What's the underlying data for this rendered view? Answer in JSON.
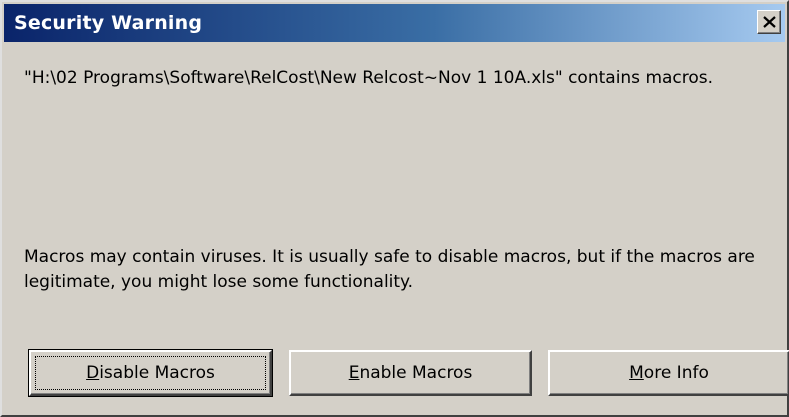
{
  "window": {
    "title": "Security Warning",
    "close_glyph": "×"
  },
  "message": {
    "line1": "\"H:\\02 Programs\\Software\\RelCost\\New Relcost~Nov 1 10A.xls\" contains macros.",
    "line2": "Macros may contain viruses. It is usually safe to disable macros, but if the macros are legitimate, you might lose some functionality."
  },
  "buttons": {
    "disable": {
      "mnemonic": "D",
      "rest": "isable Macros"
    },
    "enable": {
      "mnemonic": "E",
      "rest": "nable Macros"
    },
    "more": {
      "mnemonic": "M",
      "rest": "ore Info"
    }
  },
  "colors": {
    "titlebar_start": "#0a246a",
    "titlebar_end": "#a6caf0",
    "window_bg": "#d4d0c8"
  }
}
